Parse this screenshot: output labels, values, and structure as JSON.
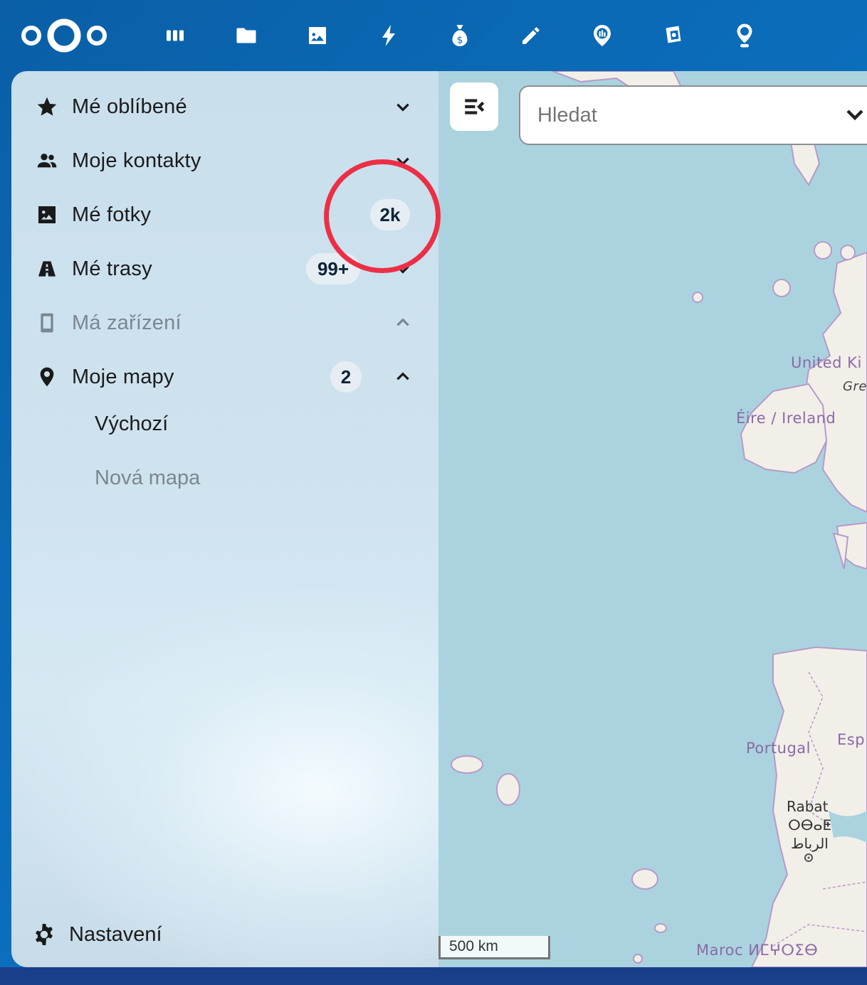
{
  "header": {
    "apps": [
      {
        "name": "dashboard-icon"
      },
      {
        "name": "files-icon"
      },
      {
        "name": "photos-icon"
      },
      {
        "name": "activity-icon"
      },
      {
        "name": "cospend-icon"
      },
      {
        "name": "notes-icon"
      },
      {
        "name": "phonetrack-icon"
      },
      {
        "name": "memories-icon"
      },
      {
        "name": "maps-icon"
      }
    ]
  },
  "sidebar": {
    "items": [
      {
        "label": "Mé oblíbené",
        "icon": "star-icon",
        "chevron": "down"
      },
      {
        "label": "Moje kontakty",
        "icon": "contacts-icon",
        "chevron": "down"
      },
      {
        "label": "Mé fotky",
        "icon": "image-icon",
        "badge": "2k"
      },
      {
        "label": "Mé trasy",
        "icon": "road-icon",
        "badge": "99+",
        "chevron": "down"
      },
      {
        "label": "Má zařízení",
        "icon": "phone-icon",
        "chevron": "up",
        "muted": true
      },
      {
        "label": "Moje mapy",
        "icon": "map-marker-icon",
        "badge": "2",
        "chevron": "up"
      }
    ],
    "maps": [
      {
        "label": "Výchozí"
      },
      {
        "label": "Nová mapa",
        "muted": true
      }
    ],
    "settings_label": "Nastavení"
  },
  "map": {
    "search_placeholder": "Hledat",
    "scale_label": "500 km",
    "labels": {
      "uk": "United Ki",
      "gb": "Gre",
      "ireland": "Éire / Ireland",
      "portugal": "Portugal",
      "spain": "Esp",
      "rabat": "Rabat",
      "rabat_tifinagh": "ⵔⴱⴰⵟ",
      "rabat_arabic": "الرباط",
      "morocco": "Maroc ⵍⵎⵖⵔⵉⴱ"
    }
  },
  "colors": {
    "header_blue": "#0b66b2",
    "sea": "#aad3df",
    "land": "#f2efe9",
    "annotation_red": "#ec2f46"
  }
}
